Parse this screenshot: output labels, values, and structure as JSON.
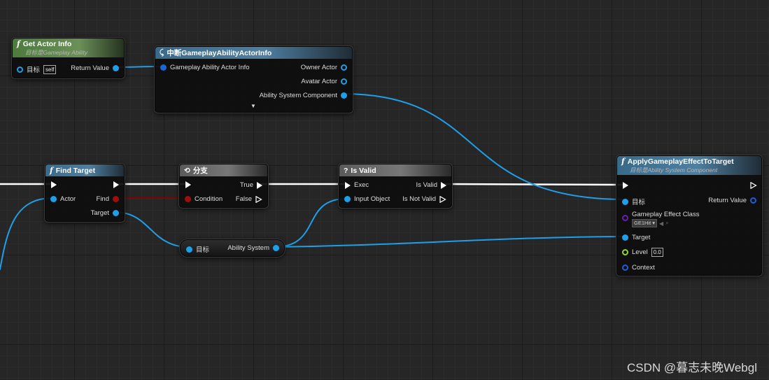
{
  "nodes": {
    "get_actor_info": {
      "title": "Get Actor Info",
      "subtitle": "目标是Gameplay Ability",
      "target_label": "目标",
      "target_value": "self",
      "return_label": "Return Value"
    },
    "break_info": {
      "title": "中断GameplayAbilityActorInfo",
      "input_label": "Gameplay Ability Actor Info",
      "owner_label": "Owner Actor",
      "avatar_label": "Avatar Actor",
      "asc_label": "Ability System Component",
      "expand_glyph": "▼"
    },
    "find_target": {
      "title": "Find Target",
      "actor_label": "Actor",
      "find_label": "Find",
      "target_label": "Target"
    },
    "branch": {
      "title": "分支",
      "condition_label": "Condition",
      "true_label": "True",
      "false_label": "False"
    },
    "is_valid": {
      "title": "Is Valid",
      "icon": "?",
      "exec_label": "Exec",
      "input_label": "Input Object",
      "valid_label": "Is Valid",
      "not_valid_label": "Is Not Valid"
    },
    "get_asc": {
      "target_label": "目标",
      "output_label": "Ability System"
    },
    "apply_effect": {
      "title": "ApplyGameplayEffectToTarget",
      "subtitle": "目标是Ability System Component",
      "target_label": "目标",
      "return_label": "Return Value",
      "effect_class_label": "Gameplay Effect Class",
      "effect_class_value": "GE1Hit",
      "target_pin_label": "Target",
      "level_label": "Level",
      "level_value": "0.0",
      "context_label": "Context"
    }
  },
  "watermark": "CSDN @暮志未晚Webgl",
  "colors": {
    "exec_wire": "#ffffff",
    "object_wire": "#1f9fe8",
    "bool_wire": "#8b0000",
    "header_green": "#5b8549",
    "header_blue": "#466f8f",
    "header_gray": "#666666"
  }
}
